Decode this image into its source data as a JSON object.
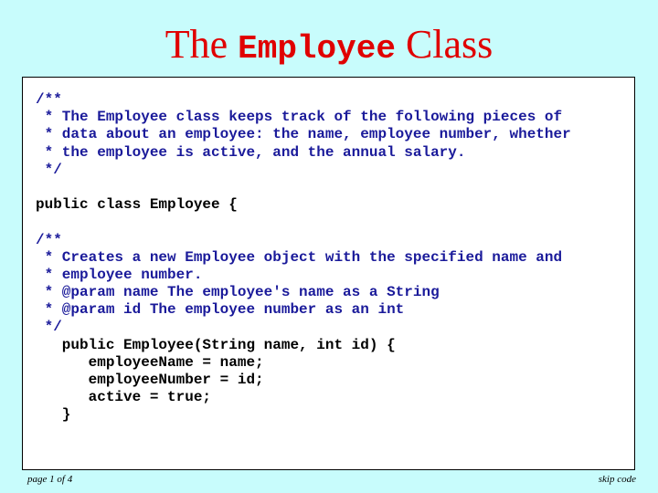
{
  "title": {
    "prefix": "The ",
    "code_word": "Employee",
    "suffix": " Class"
  },
  "code": {
    "lines": [
      {
        "text": "/**",
        "kind": "comment"
      },
      {
        "text": " * The Employee class keeps track of the following pieces of",
        "kind": "comment"
      },
      {
        "text": " * data about an employee: the name, employee number, whether",
        "kind": "comment"
      },
      {
        "text": " * the employee is active, and the annual salary.",
        "kind": "comment"
      },
      {
        "text": " */",
        "kind": "comment"
      },
      {
        "text": "",
        "kind": "plain"
      },
      {
        "text": "public class Employee {",
        "kind": "plain"
      },
      {
        "text": "",
        "kind": "plain"
      },
      {
        "text": "/**",
        "kind": "comment"
      },
      {
        "text": " * Creates a new Employee object with the specified name and",
        "kind": "comment"
      },
      {
        "text": " * employee number.",
        "kind": "comment"
      },
      {
        "text": " * @param name The employee's name as a String",
        "kind": "comment"
      },
      {
        "text": " * @param id The employee number as an int",
        "kind": "comment"
      },
      {
        "text": " */",
        "kind": "comment"
      },
      {
        "text": "   public Employee(String name, int id) {",
        "kind": "plain"
      },
      {
        "text": "      employeeName = name;",
        "kind": "plain"
      },
      {
        "text": "      employeeNumber = id;",
        "kind": "plain"
      },
      {
        "text": "      active = true;",
        "kind": "plain"
      },
      {
        "text": "   }",
        "kind": "plain"
      }
    ]
  },
  "footer": {
    "page_label": "page 1 of 4",
    "skip_label": "skip code"
  },
  "colors": {
    "background": "#c8fcfc",
    "title": "#e00000",
    "comment": "#1a1a9a",
    "code": "#000000"
  }
}
